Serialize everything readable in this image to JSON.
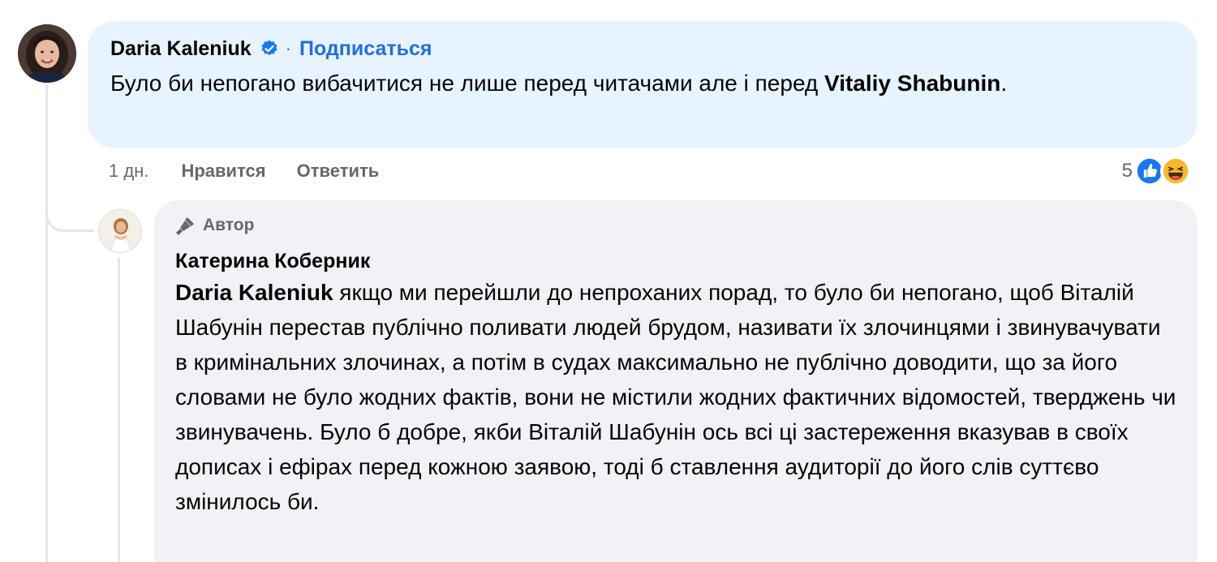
{
  "comment": {
    "author": "Daria Kaleniuk",
    "separator": "·",
    "follow_label": "Подписаться",
    "text_part1": "Було би непогано вибачитися не лише перед читачами але і перед ",
    "mention": "Vitaliy Shabunin",
    "text_part2": ".",
    "time": "1 дн.",
    "like_label": "Нравится",
    "reply_label": "Ответить",
    "reaction_count": "5"
  },
  "reply": {
    "badge": "Автор",
    "author": "Катерина Коберник",
    "mention": "Daria Kaleniuk",
    "text": " якщо ми перейшли до непроханих порад, то було би непогано, щоб Віталій Шабунін перестав публічно поливати людей брудом, називати їх злочинцями і звинувачувати в кримінальних злочинах, а потім в судах максимально не публічно доводити, що за його словами не було жодних фактів, вони не містили жодних фактичних відомостей, тверджень чи звинувачень. Було б добре, якби Віталій Шабунін ось всі ці застереження вказував в своїх дописах і ефірах перед кожною заявою, тоді б ставлення аудиторії до його слів суттєво змінилось би."
  },
  "colors": {
    "main_bubble": "#e7f3ff",
    "reply_bubble": "#f0f2f5",
    "link_blue": "#216fdb",
    "muted": "#65676b",
    "like_blue": "#1877f2",
    "haha_yellow": "#f7b928"
  },
  "icons": {
    "verified": "verified-badge-icon",
    "author_badge": "microphone-icon",
    "like": "like-icon",
    "haha": "haha-icon"
  }
}
